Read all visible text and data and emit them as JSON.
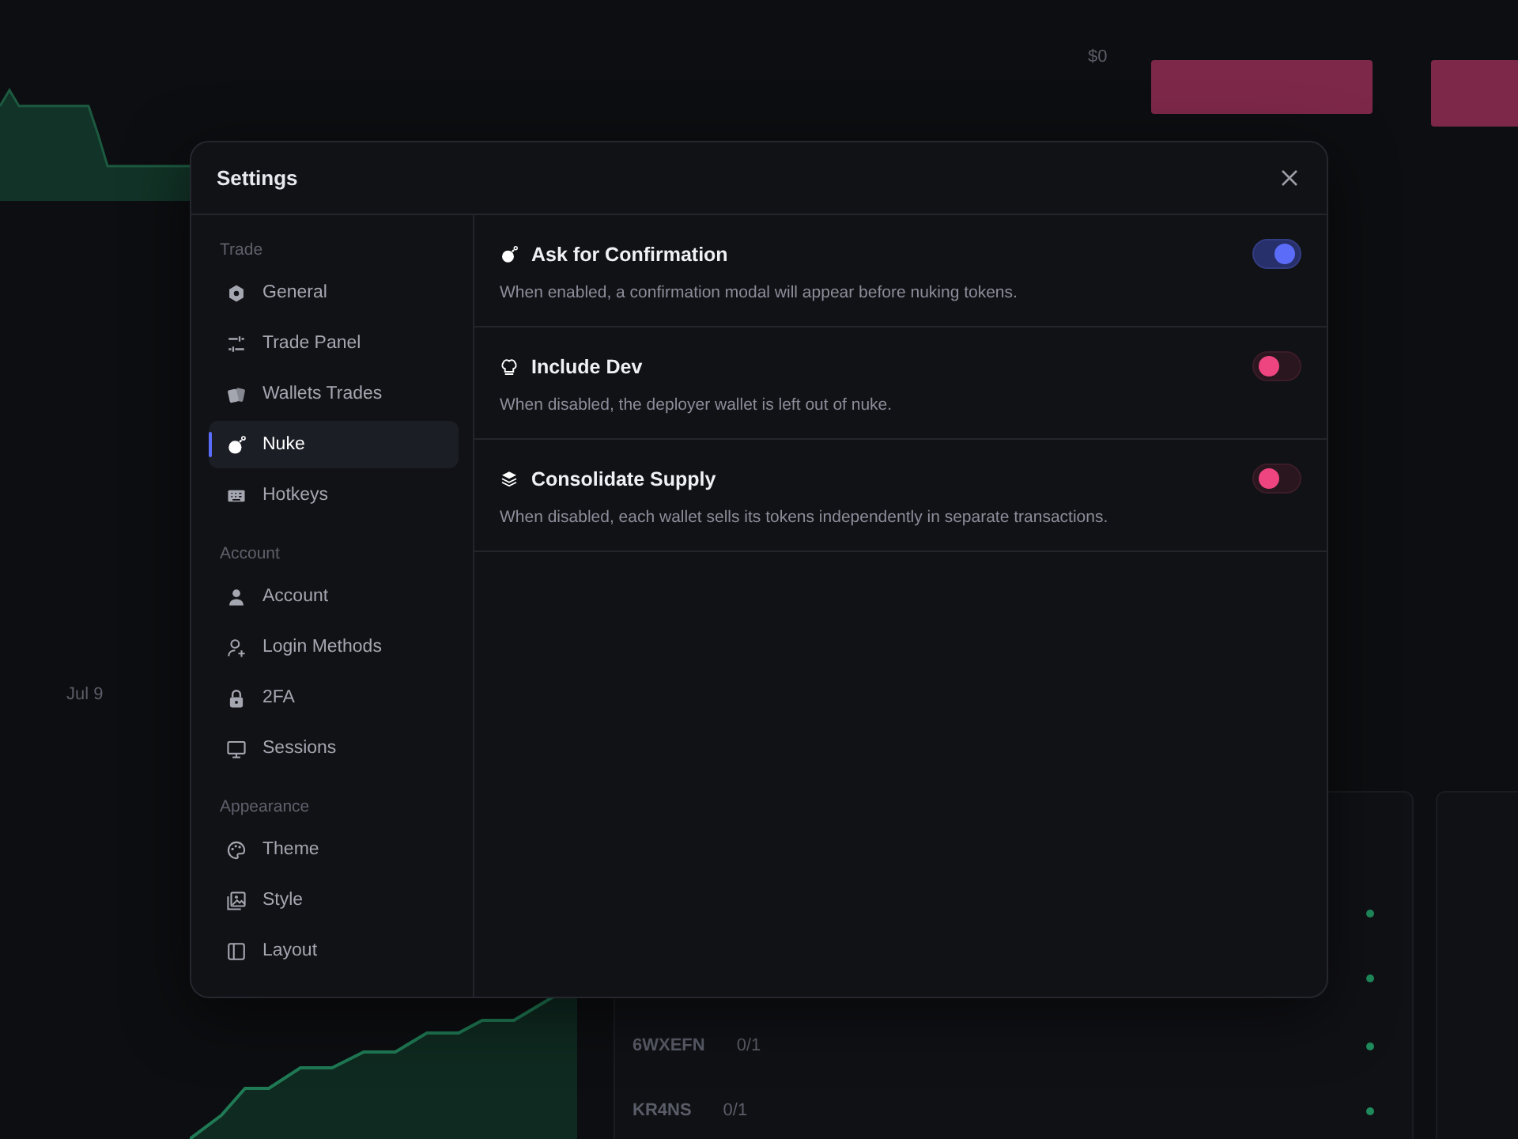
{
  "background": {
    "price_label": "$0",
    "date_label": "Jul 9",
    "rows": [
      {
        "wallet": "6WXEFN",
        "count": "0/1"
      },
      {
        "wallet": "KR4NS",
        "count": "0/1"
      }
    ]
  },
  "dialog": {
    "title": "Settings",
    "sidebar": {
      "groups": [
        {
          "label": "Trade",
          "items": [
            {
              "label": "General",
              "selected": false
            },
            {
              "label": "Trade Panel",
              "selected": false
            },
            {
              "label": "Wallets Trades",
              "selected": false
            },
            {
              "label": "Nuke",
              "selected": true
            },
            {
              "label": "Hotkeys",
              "selected": false
            }
          ]
        },
        {
          "label": "Account",
          "items": [
            {
              "label": "Account",
              "selected": false
            },
            {
              "label": "Login Methods",
              "selected": false
            },
            {
              "label": "2FA",
              "selected": false
            },
            {
              "label": "Sessions",
              "selected": false
            }
          ]
        },
        {
          "label": "Appearance",
          "items": [
            {
              "label": "Theme",
              "selected": false
            },
            {
              "label": "Style",
              "selected": false
            },
            {
              "label": "Layout",
              "selected": false
            }
          ]
        }
      ]
    },
    "settings": [
      {
        "title": "Ask for Confirmation",
        "description": "When enabled, a confirmation modal will appear before nuking tokens.",
        "on": true
      },
      {
        "title": "Include Dev",
        "description": "When disabled, the deployer wallet is left out of nuke.",
        "on": false
      },
      {
        "title": "Consolidate Supply",
        "description": "When disabled, each wallet sells its tokens independently in separate transactions.",
        "on": false
      }
    ]
  }
}
